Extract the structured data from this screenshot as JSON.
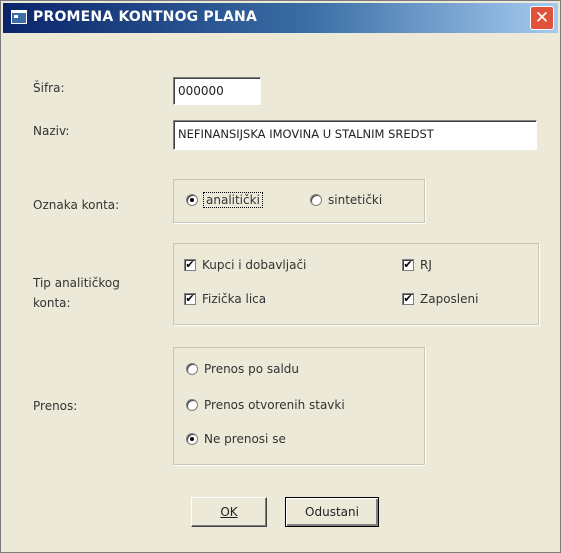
{
  "window": {
    "title": "PROMENA KONTNOG PLANA",
    "close_glyph": "✕",
    "app_icon": "app-window-icon"
  },
  "fields": {
    "sifra_label": "Šifra:",
    "sifra_value": "000000",
    "naziv_label": "Naziv:",
    "naziv_value": "NEFINANSIJSKA IMOVINA U STALNIM SREDST"
  },
  "oznaka": {
    "label": "Oznaka konta:",
    "options": [
      {
        "label": "analitički",
        "selected": true
      },
      {
        "label": "sintetički",
        "selected": false
      }
    ]
  },
  "tip": {
    "label_line1": "Tip analitičkog",
    "label_line2": "konta:",
    "checks": [
      {
        "label": "Kupci i dobavljači",
        "checked": true
      },
      {
        "label": "RJ",
        "checked": true
      },
      {
        "label": "Fizička lica",
        "checked": true
      },
      {
        "label": "Zaposleni",
        "checked": true
      }
    ],
    "check_glyph": "✔"
  },
  "prenos": {
    "label": "Prenos:",
    "options": [
      {
        "label": "Prenos po saldu",
        "selected": false
      },
      {
        "label": "Prenos otvorenih stavki",
        "selected": false
      },
      {
        "label": "Ne prenosi se",
        "selected": true
      }
    ]
  },
  "buttons": {
    "ok": "OK",
    "cancel": "Odustani"
  }
}
